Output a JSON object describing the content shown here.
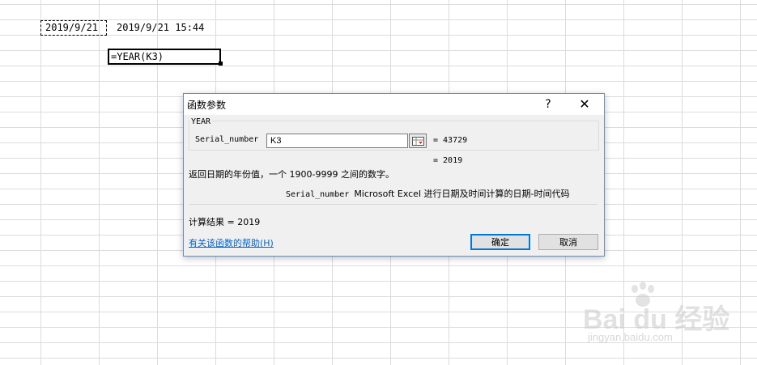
{
  "sheet": {
    "cell_k3": "2019/9/21",
    "cell_l3": "2019/9/21 15:44",
    "cell_l5": "=YEAR(K3)"
  },
  "dialog": {
    "title": "函数参数",
    "help_glyph": "?",
    "close_glyph": "✕",
    "function_name": "YEAR",
    "argument": {
      "label": "Serial_number",
      "value": "K3",
      "evaluated": "= 43729"
    },
    "formula_result": "= 2019",
    "description": "返回日期的年份值，一个 1900-9999 之间的数字。",
    "arg_description_name": "Serial_number",
    "arg_description_text": "Microsoft Excel 进行日期及时间计算的日期-时间代码",
    "calc_result": "计算结果 = 2019",
    "help_link": "有关该函数的帮助(H)",
    "ok_label": "确定",
    "cancel_label": "取消"
  },
  "watermark": {
    "brand": "Bai du 经验",
    "url": "jingyan.baidu.com"
  },
  "colors": {
    "dialog_border": "#6a8bbd",
    "link": "#0066cc",
    "ok_focus": "#0078d7"
  }
}
